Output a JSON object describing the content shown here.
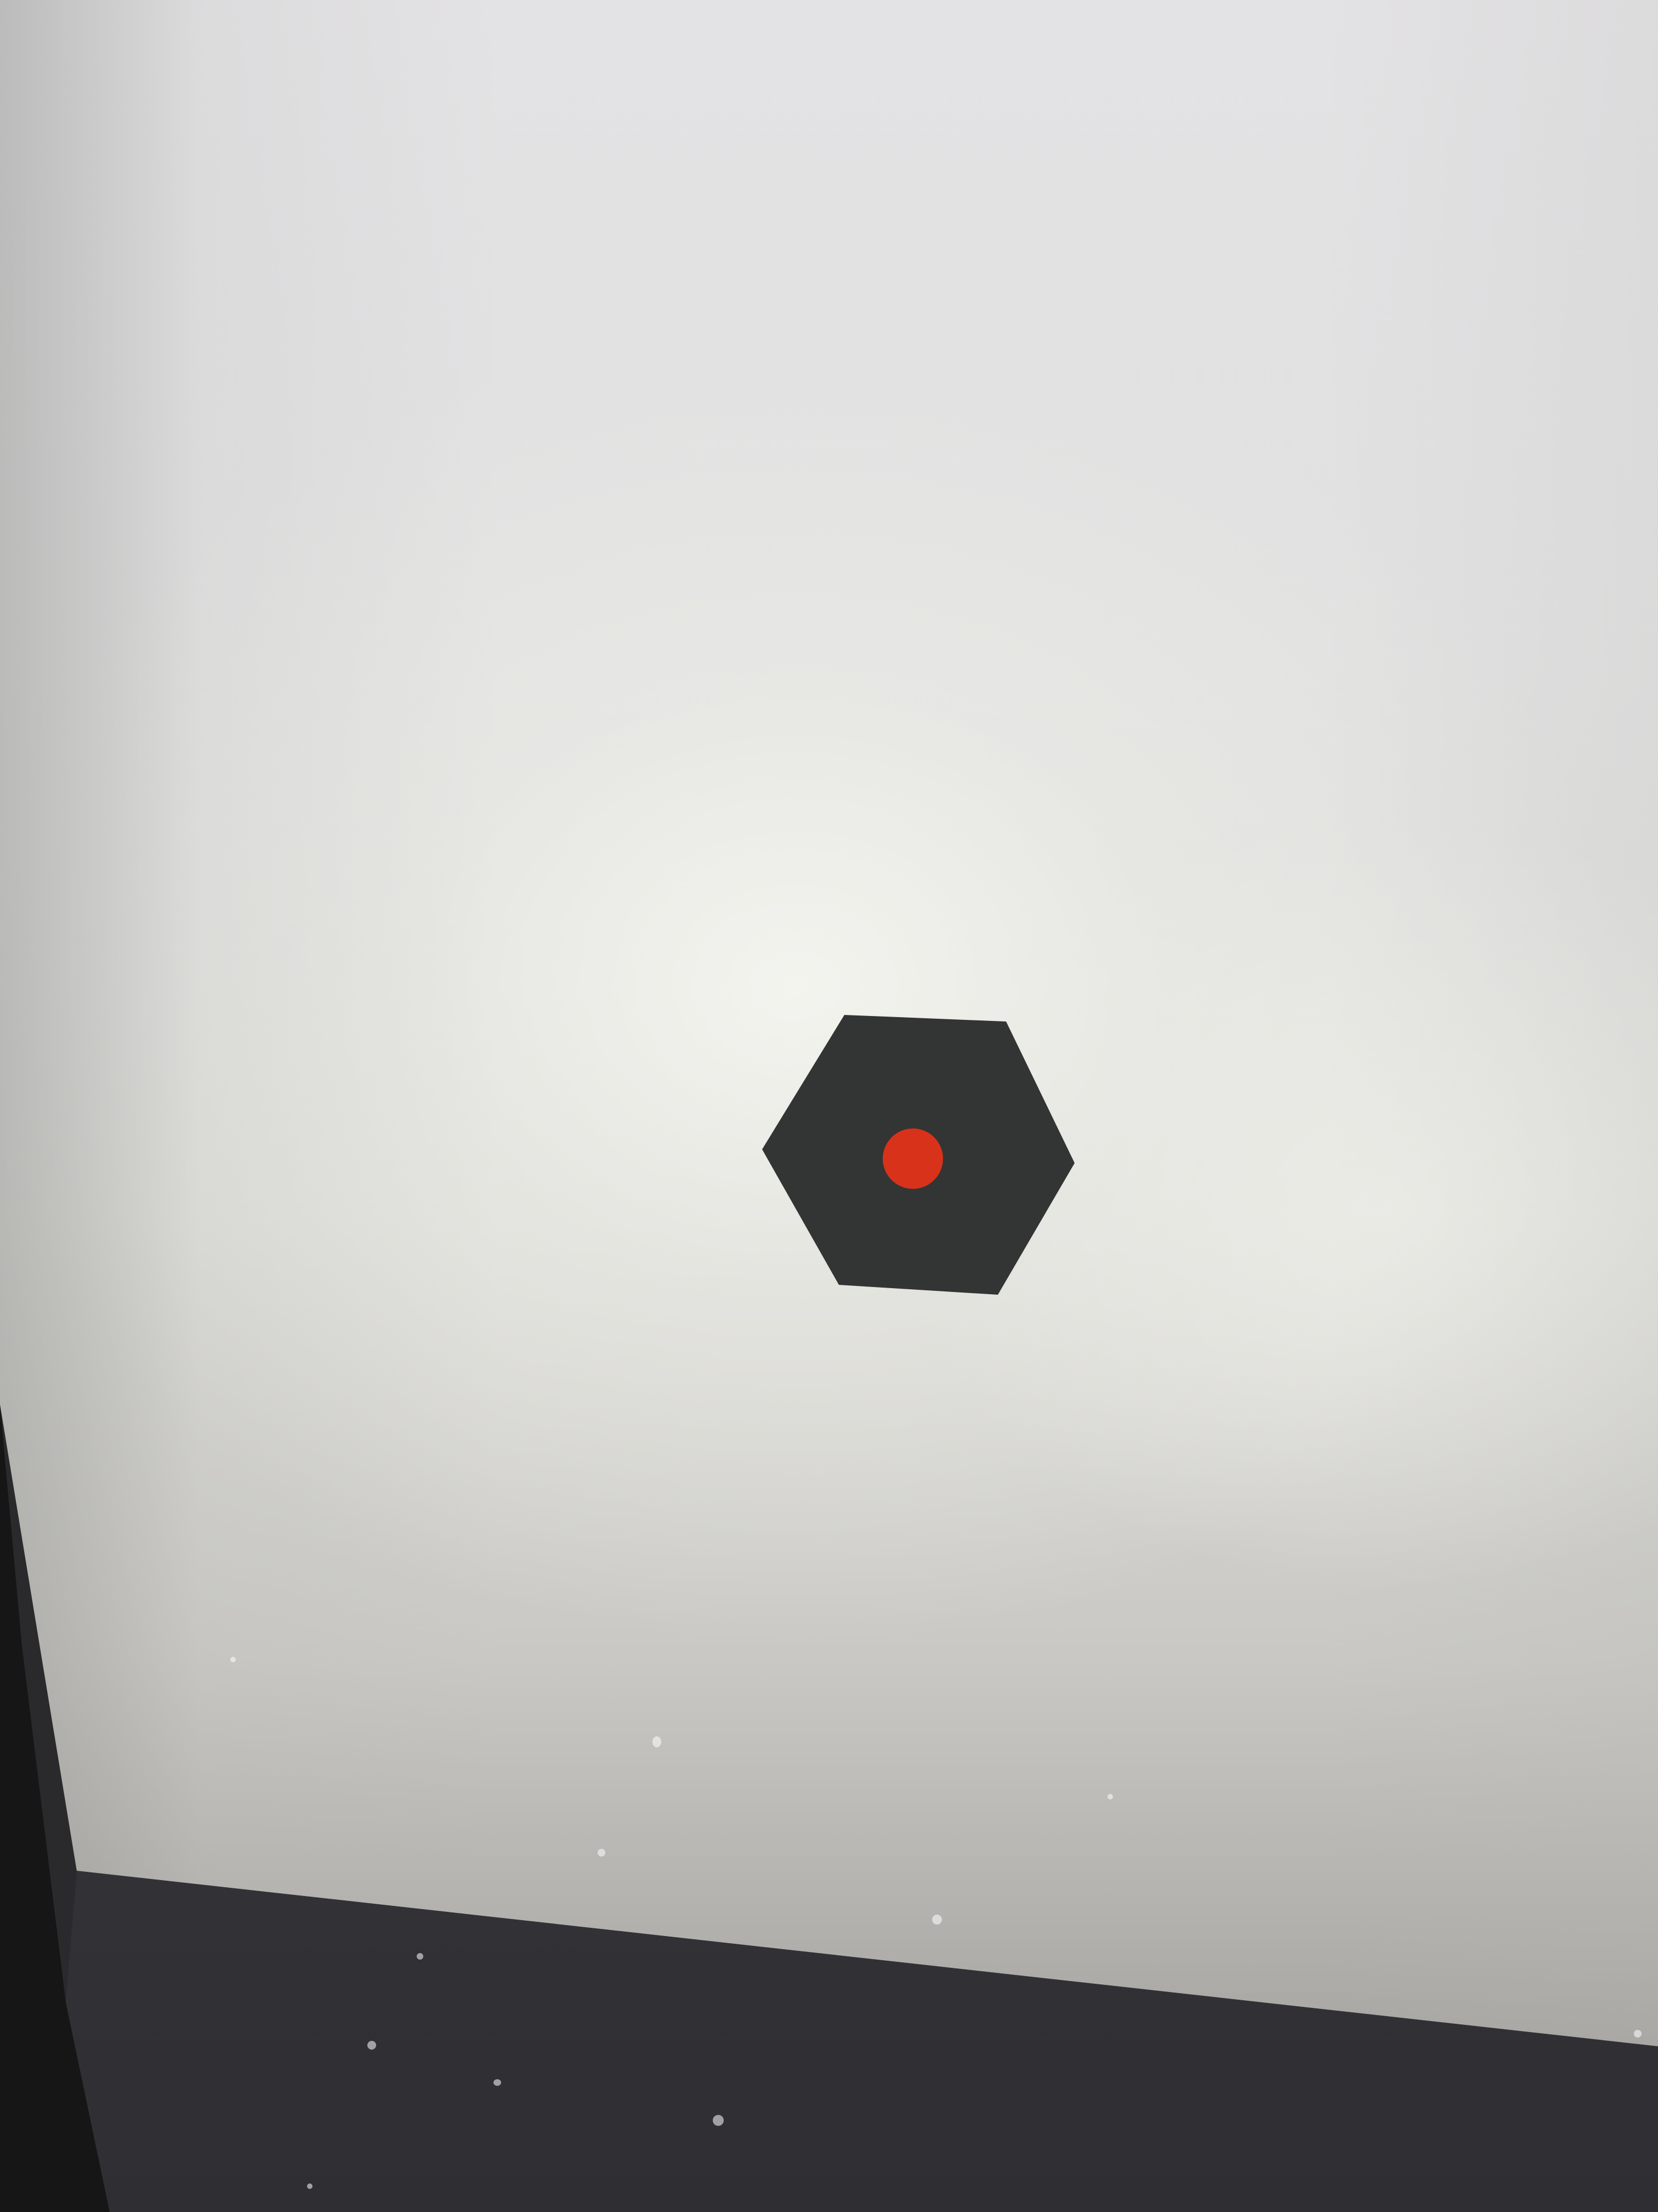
{
  "scene": {
    "screen_color": "#e2e2e0",
    "taskbar_color": "#3b3b40",
    "bezel_color": "#161617"
  },
  "symbol": {
    "icon": "hexagon-with-red-dot",
    "hexagon_color": "#333434",
    "dot_color": "#d9321a"
  }
}
